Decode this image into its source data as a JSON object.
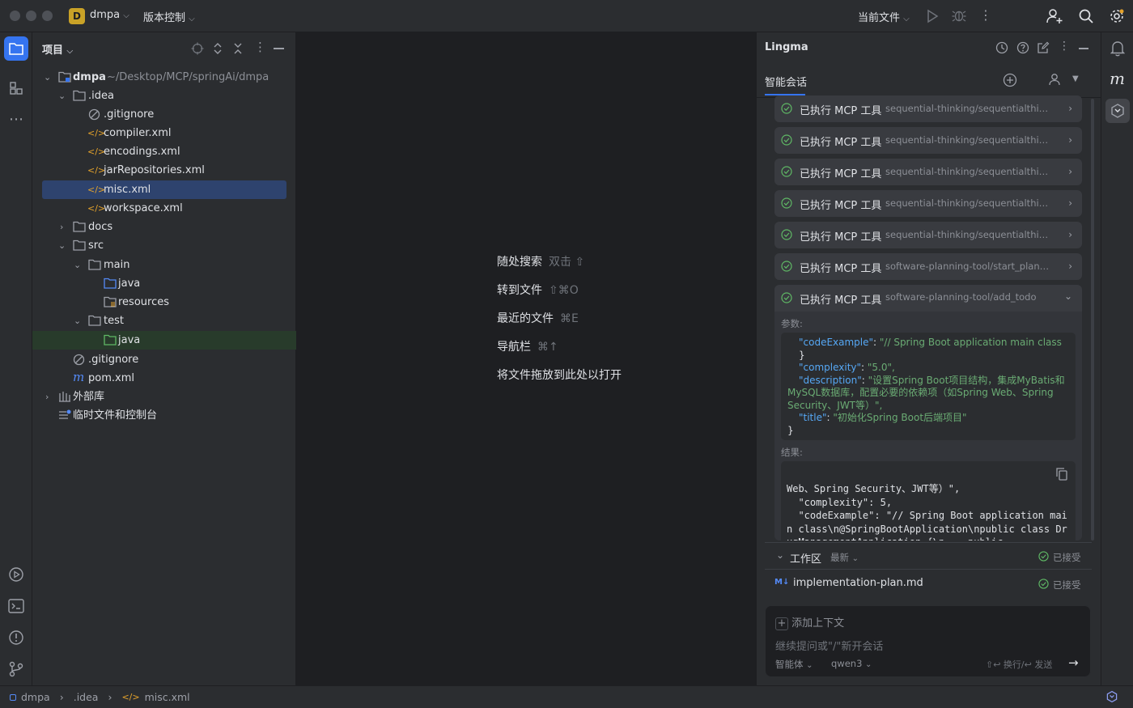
{
  "titlebar": {
    "project_badge": "D",
    "project_name": "dmpa",
    "vcs_label": "版本控制",
    "run_config": "当前文件"
  },
  "project_panel": {
    "title": "项目",
    "tree": [
      {
        "label": "dmpa",
        "suffix": "~/Desktop/MCP/springAi/dmpa",
        "icon": "folder-icon"
      },
      {
        "label": ".idea",
        "icon": "folder-icon"
      },
      {
        "label": ".gitignore",
        "icon": "ignore-icon"
      },
      {
        "label": "compiler.xml",
        "icon": "xml-icon"
      },
      {
        "label": "encodings.xml",
        "icon": "xml-icon"
      },
      {
        "label": "jarRepositories.xml",
        "icon": "xml-icon"
      },
      {
        "label": "misc.xml",
        "icon": "xml-icon"
      },
      {
        "label": "workspace.xml",
        "icon": "xml-icon"
      },
      {
        "label": "docs",
        "icon": "folder-icon"
      },
      {
        "label": "src",
        "icon": "folder-icon"
      },
      {
        "label": "main",
        "icon": "folder-icon"
      },
      {
        "label": "java",
        "icon": "source-folder-icon"
      },
      {
        "label": "resources",
        "icon": "resources-folder-icon"
      },
      {
        "label": "test",
        "icon": "folder-icon"
      },
      {
        "label": "java",
        "icon": "test-folder-icon"
      },
      {
        "label": ".gitignore",
        "icon": "ignore-icon"
      },
      {
        "label": "pom.xml",
        "icon": "maven-icon"
      },
      {
        "label": "外部库",
        "icon": "library-icon"
      },
      {
        "label": "临时文件和控制台",
        "icon": "scratch-icon"
      }
    ]
  },
  "editor_hints": [
    {
      "label": "随处搜索",
      "key": "双击 ⇧"
    },
    {
      "label": "转到文件",
      "key": "⇧⌘O"
    },
    {
      "label": "最近的文件",
      "key": "⌘E"
    },
    {
      "label": "导航栏",
      "key": "⌘↑"
    },
    {
      "label": "将文件拖放到此处以打开",
      "key": ""
    }
  ],
  "lingma": {
    "title": "Lingma",
    "tab": "智能会话",
    "mcp_items": [
      {
        "label": "已执行 MCP 工具",
        "detail": "sequential-thinking/sequentialthinking"
      },
      {
        "label": "已执行 MCP 工具",
        "detail": "sequential-thinking/sequentialthinking"
      },
      {
        "label": "已执行 MCP 工具",
        "detail": "sequential-thinking/sequentialthinking"
      },
      {
        "label": "已执行 MCP 工具",
        "detail": "sequential-thinking/sequentialthinking"
      },
      {
        "label": "已执行 MCP 工具",
        "detail": "sequential-thinking/sequentialthinking"
      },
      {
        "label": "已执行 MCP 工具",
        "detail": "software-planning-tool/start_planning"
      }
    ],
    "expanded": {
      "label": "已执行 MCP 工具",
      "detail": "software-planning-tool/add_todo",
      "params_label": "参数:",
      "params_lines": [
        {
          "key": "\"codeExample\"",
          "value": "\"// Spring Boot application main class"
        },
        {
          "key": "",
          "value": "}"
        },
        {
          "key": "\"complexity\"",
          "value": "\"5.0\","
        },
        {
          "key": "\"description\"",
          "value": "\"设置Spring Boot项目结构，集成MyBatis和MySQL数据库，配置必要的依赖项（如Spring Web、Spring Security、JWT等）\","
        },
        {
          "key": "\"title\"",
          "value": "\"初始化Spring Boot后端项目\""
        },
        {
          "key": "",
          "value": "}"
        }
      ],
      "result_label": "结果:",
      "result_text": "Web、Spring Security、JWT等）\",\n  \"complexity\": 5,\n  \"codeExample\": \"// Spring Boot application main class\\n@SpringBootApplication\\npublic class DrugManagementApplication {\\n    public"
    },
    "workspace": {
      "title": "工作区",
      "filter": "最新",
      "status": "已接受",
      "file": "implementation-plan.md",
      "file_badge": "M↓",
      "file_status": "已接受"
    },
    "input": {
      "add_context": "添加上下文",
      "placeholder": "继续提问或\"/\"新开会话",
      "mode": "智能体",
      "model": "qwen3",
      "shortcut_hint": "⇧↩ 换行/↩ 发送"
    }
  },
  "breadcrumb": [
    "dmpa",
    ".idea",
    "misc.xml"
  ]
}
